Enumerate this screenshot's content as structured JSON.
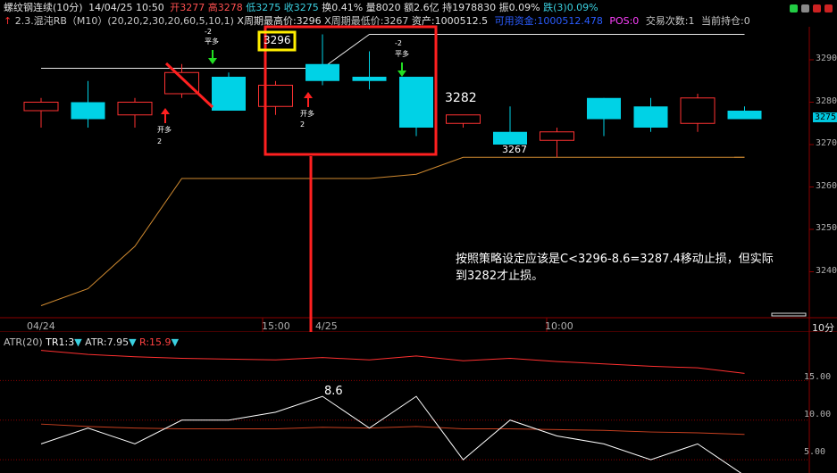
{
  "header": {
    "instrument": "螺纹钢连续",
    "period": "(10分)",
    "datetime": "14/04/25 10:50",
    "open": "开3277",
    "high": "高3278",
    "low": "低3275",
    "close": "收3275",
    "turnover": "换0.41%",
    "volume": "量8020",
    "amount": "额2.6亿",
    "position": "持1978830",
    "amplitude": "振0.09%",
    "change": "跌(3)0.09%"
  },
  "strategy_bar": {
    "arrow": "↑",
    "name": "2.3.混沌RB（M10）(20,20,2,30,20,60,5,10,1)",
    "x_high": "X周期最高价:3296",
    "x_low": "X周期最低价:3267",
    "assets": "资产:1000512.5",
    "available": "可用资金:1000512.478",
    "pos": "POS:0",
    "trades": "交易次数:1",
    "holding": "当前持仓:0"
  },
  "colors": {
    "up": "#ff3232",
    "down": "#00d2e6",
    "grid": "#8b0000",
    "upper_band": "#e8e8e8",
    "lower_band": "#d08a30",
    "highlight_box": "#ff2020",
    "yellow_box": "#ffee00",
    "buy_arrow": "#ff2020",
    "sell_arrow": "#22dd22",
    "atr_line": "#ffffff",
    "r_line": "#ff3030"
  },
  "y_axis": {
    "ticks": [
      "3290",
      "3280",
      "3270",
      "3260",
      "3250",
      "3240"
    ],
    "current_price_tag": "3275"
  },
  "x_axis": {
    "labels": [
      "04/24",
      "15:00",
      "4/25",
      "10:00"
    ],
    "period_label": "10分"
  },
  "chart_data": {
    "type": "candlestick",
    "candles": [
      {
        "o": 3278,
        "h": 3281,
        "l": 3274,
        "c": 3280
      },
      {
        "o": 3280,
        "h": 3285,
        "l": 3274,
        "c": 3276
      },
      {
        "o": 3277,
        "h": 3281,
        "l": 3274,
        "c": 3280
      },
      {
        "o": 3282,
        "h": 3289,
        "l": 3281,
        "c": 3287
      },
      {
        "o": 3286,
        "h": 3287,
        "l": 3278,
        "c": 3278
      },
      {
        "o": 3279,
        "h": 3285,
        "l": 3277,
        "c": 3284
      },
      {
        "o": 3289,
        "h": 3296,
        "l": 3284,
        "c": 3285
      },
      {
        "o": 3286,
        "h": 3292,
        "l": 3283,
        "c": 3285
      },
      {
        "o": 3286,
        "h": 3286,
        "l": 3272,
        "c": 3274
      },
      {
        "o": 3275,
        "h": 3277,
        "l": 3274,
        "c": 3277
      },
      {
        "o": 3273,
        "h": 3279,
        "l": 3270,
        "c": 3270
      },
      {
        "o": 3271,
        "h": 3274,
        "l": 3267,
        "c": 3273
      },
      {
        "o": 3281,
        "h": 3281,
        "l": 3272,
        "c": 3276
      },
      {
        "o": 3279,
        "h": 3281,
        "l": 3273,
        "c": 3274
      },
      {
        "o": 3275,
        "h": 3282,
        "l": 3273,
        "c": 3281
      },
      {
        "o": 3278,
        "h": 3279,
        "l": 3276,
        "c": 3276
      }
    ],
    "upper_band": [
      3288,
      3288,
      3288,
      3288,
      3288,
      3288,
      3288,
      3296,
      3296,
      3296,
      3296,
      3296,
      3296,
      3296,
      3296,
      3296
    ],
    "lower_band": [
      3232,
      3236,
      3246,
      3262,
      3262,
      3262,
      3262,
      3262,
      3263,
      3267,
      3267,
      3267,
      3267,
      3267,
      3267,
      3267
    ],
    "atr_panel": {
      "label": "ATR(20)",
      "tr_label": "TR1:3",
      "atr_label": "ATR:7.95",
      "r_label": "R:15.9",
      "tr": [
        7,
        9,
        7,
        10,
        10,
        11,
        13,
        9,
        13,
        5,
        10,
        8,
        7,
        5,
        7,
        3
      ],
      "atr": [
        9.5,
        9.2,
        9.0,
        8.9,
        8.9,
        8.9,
        9.1,
        9.0,
        9.2,
        8.9,
        8.9,
        8.8,
        8.7,
        8.5,
        8.4,
        8.2
      ],
      "r": [
        18.8,
        18.3,
        18.0,
        17.8,
        17.7,
        17.6,
        17.9,
        17.6,
        18.1,
        17.5,
        17.8,
        17.4,
        17.1,
        16.8,
        16.6,
        15.9
      ],
      "y_ticks": [
        "15.00",
        "10.00",
        "5.00"
      ],
      "ylim": [
        4,
        20
      ]
    }
  },
  "chart_labels": {
    "yellow_box_value": "3296",
    "stop_price": "3282",
    "x_low_value": "3267",
    "atr_point_value": "8.6",
    "open_long_1": "开多",
    "open_long_1_qty": "2",
    "flat_long_1_qty": "-2",
    "flat_long_1": "平多",
    "open_long_2": "开多",
    "open_long_2_qty": "2",
    "flat_long_2_qty": "-2",
    "flat_long_2": "平多"
  },
  "annotation": {
    "line1": "按照策略设定应该是C<3296-8.6=3287.4移动止损，但实际",
    "line2": "到3282才止损。"
  }
}
